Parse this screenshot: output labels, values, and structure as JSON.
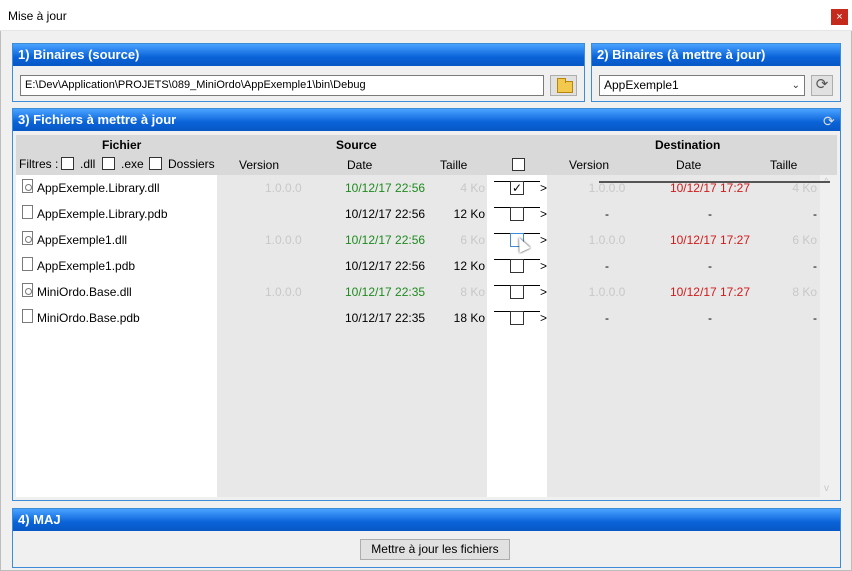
{
  "window": {
    "title": "Mise à jour",
    "close_glyph": "×"
  },
  "group1": {
    "title": "1) Binaires (source)",
    "path": "E:\\Dev\\Application\\PROJETS\\089_MiniOrdo\\AppExemple1\\bin\\Debug",
    "browse_icon": "folder-icon"
  },
  "group2": {
    "title": "2) Binaires (à mettre à jour)",
    "selected": "AppExemple1",
    "refresh_glyph": "⟳"
  },
  "group3": {
    "title": "3) Fichiers à mettre à jour",
    "refresh_glyph": "⟳",
    "headers": {
      "fichier": "Fichier",
      "source": "Source",
      "destination": "Destination",
      "filtres": "Filtres :",
      "dll": ".dll",
      "exe": ".exe",
      "dossiers": "Dossiers",
      "src_version": "Version",
      "src_date": "Date",
      "src_taille": "Taille",
      "dst_version": "Version",
      "dst_date": "Date",
      "dst_taille": "Taille"
    },
    "arrow_text": ">",
    "rows": [
      {
        "name": "AppExemple.Library.dll",
        "type": "dll",
        "sv": "1.0.0.0",
        "sd": "10/12/17 22:56",
        "st": "4 Ko",
        "checked": true,
        "dv": "1.0.0.0",
        "dd": "10/12/17 17:27",
        "dt": "4 Ko",
        "check_glyph": "✓"
      },
      {
        "name": "AppExemple.Library.pdb",
        "type": "pdb",
        "sv": "",
        "sd": "10/12/17 22:56",
        "st": "12 Ko",
        "checked": false,
        "dv": "-",
        "dd": "-",
        "dt": "-",
        "check_glyph": ""
      },
      {
        "name": "AppExemple1.dll",
        "type": "dll",
        "sv": "1.0.0.0",
        "sd": "10/12/17 22:56",
        "st": "6 Ko",
        "checked": false,
        "dv": "1.0.0.0",
        "dd": "10/12/17 17:27",
        "dt": "6 Ko",
        "check_glyph": ""
      },
      {
        "name": "AppExemple1.pdb",
        "type": "pdb",
        "sv": "",
        "sd": "10/12/17 22:56",
        "st": "12 Ko",
        "checked": false,
        "dv": "-",
        "dd": "-",
        "dt": "-",
        "check_glyph": ""
      },
      {
        "name": "MiniOrdo.Base.dll",
        "type": "dll",
        "sv": "1.0.0.0",
        "sd": "10/12/17 22:35",
        "st": "8 Ko",
        "checked": false,
        "dv": "1.0.0.0",
        "dd": "10/12/17 17:27",
        "dt": "8 Ko",
        "check_glyph": ""
      },
      {
        "name": "MiniOrdo.Base.pdb",
        "type": "pdb",
        "sv": "",
        "sd": "10/12/17 22:35",
        "st": "18 Ko",
        "checked": false,
        "dv": "-",
        "dd": "-",
        "dt": "-",
        "check_glyph": ""
      }
    ],
    "scroll_up": "^",
    "scroll_down": "v"
  },
  "group4": {
    "title": "4) MAJ",
    "button": "Mettre à jour les fichiers"
  },
  "colors": {
    "header_blue": "#0a63d8",
    "date_new": "#1f8a1f",
    "date_old": "#d11a1a"
  }
}
